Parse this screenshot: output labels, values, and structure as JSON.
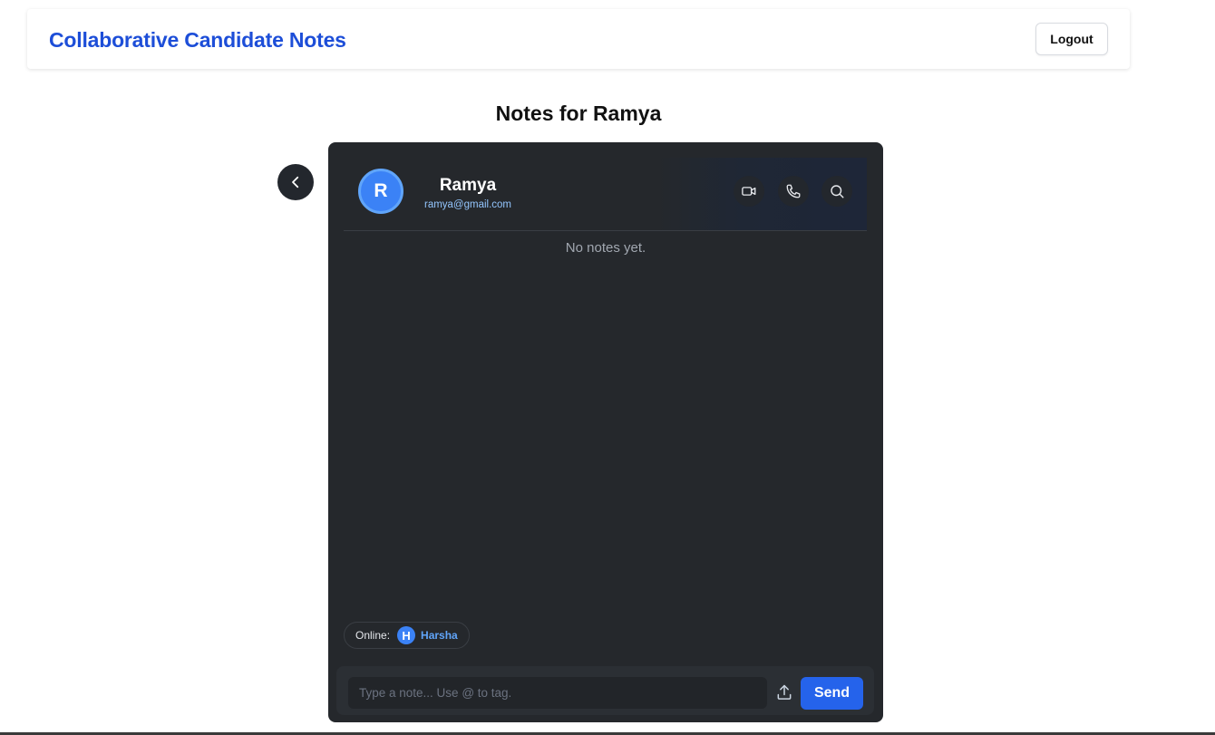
{
  "header": {
    "brand": "Collaborative Candidate Notes",
    "logout_label": "Logout"
  },
  "page": {
    "title": "Notes for Ramya"
  },
  "chat": {
    "candidate": {
      "initial": "R",
      "name": "Ramya",
      "email": "ramya@gmail.com"
    },
    "header_icons": [
      "video-icon",
      "phone-icon",
      "search-icon"
    ],
    "empty_text": "No notes yet.",
    "online": {
      "label": "Online:",
      "users": [
        {
          "initial": "H",
          "name": "Harsha"
        }
      ]
    },
    "composer": {
      "placeholder": "Type a note... Use @ to tag.",
      "value": "",
      "send_label": "Send"
    }
  },
  "colors": {
    "brand": "#1d4ed8",
    "accent": "#2563eb",
    "panel_bg": "#25282c",
    "online_name": "#60a5fa"
  }
}
